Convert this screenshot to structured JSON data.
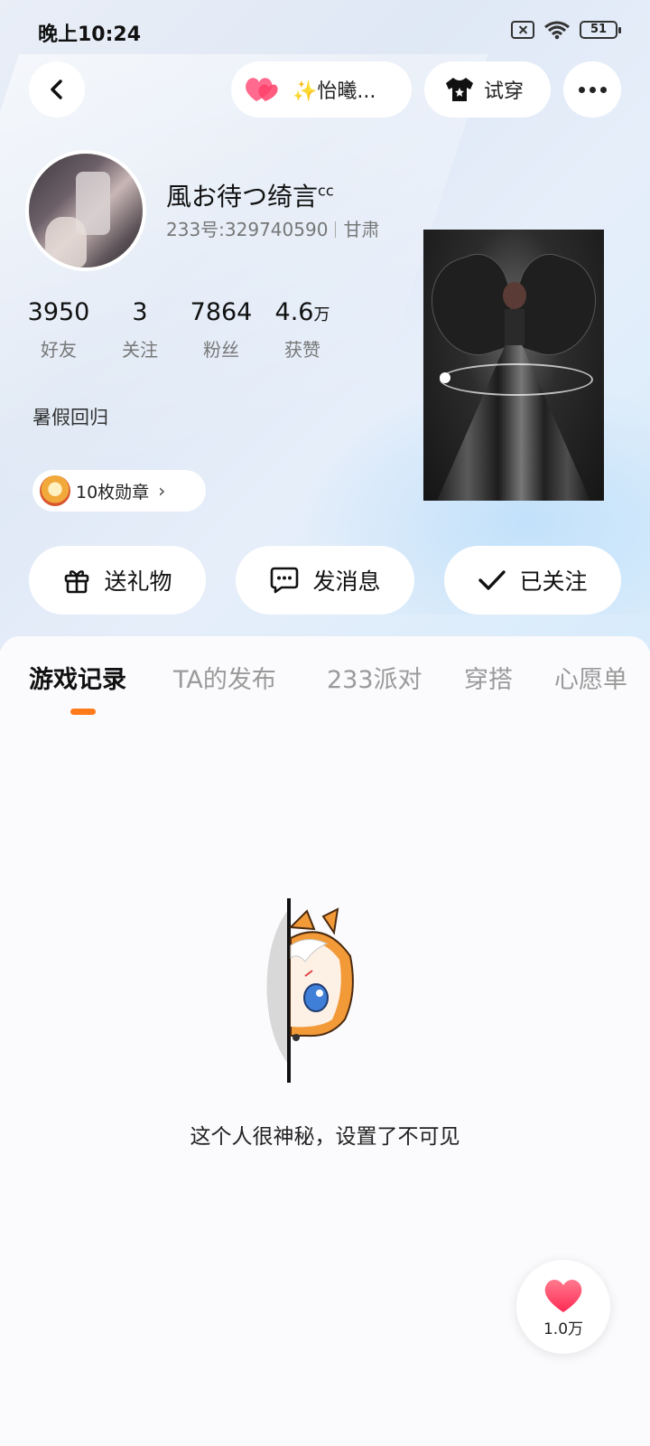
{
  "status_bar": {
    "time": "晚上10:24",
    "battery": "51"
  },
  "top_bar": {
    "partner_label": "✨怡曦...",
    "tryon_label": "试穿"
  },
  "profile": {
    "username": "風お待つ绮言",
    "username_sup": "cc",
    "id_text": "233号:329740590",
    "location": "甘肃",
    "bio": "暑假回归",
    "badge_label": "10枚勋章"
  },
  "stats": [
    {
      "value": "3950",
      "unit": "",
      "label": "好友"
    },
    {
      "value": "3",
      "unit": "",
      "label": "关注"
    },
    {
      "value": "7864",
      "unit": "",
      "label": "粉丝"
    },
    {
      "value": "4.6",
      "unit": "万",
      "label": "获赞"
    }
  ],
  "actions": {
    "gift": "送礼物",
    "message": "发消息",
    "follow": "已关注"
  },
  "tabs": [
    "游戏记录",
    "TA的发布",
    "233派对",
    "穿搭",
    "心愿单"
  ],
  "active_tab": "游戏记录",
  "empty_state": {
    "text": "这个人很神秘，设置了不可见"
  },
  "like_fab": {
    "count": "1.0万"
  },
  "colors": {
    "accent": "#ff7a1a",
    "heart": "#ff4a6e"
  },
  "icons": [
    "back-arrow-icon",
    "heart-icon",
    "tshirt-icon",
    "more-icon",
    "gift-icon",
    "chat-bubble-icon",
    "check-icon",
    "medal-icon",
    "chevron-right-icon"
  ]
}
